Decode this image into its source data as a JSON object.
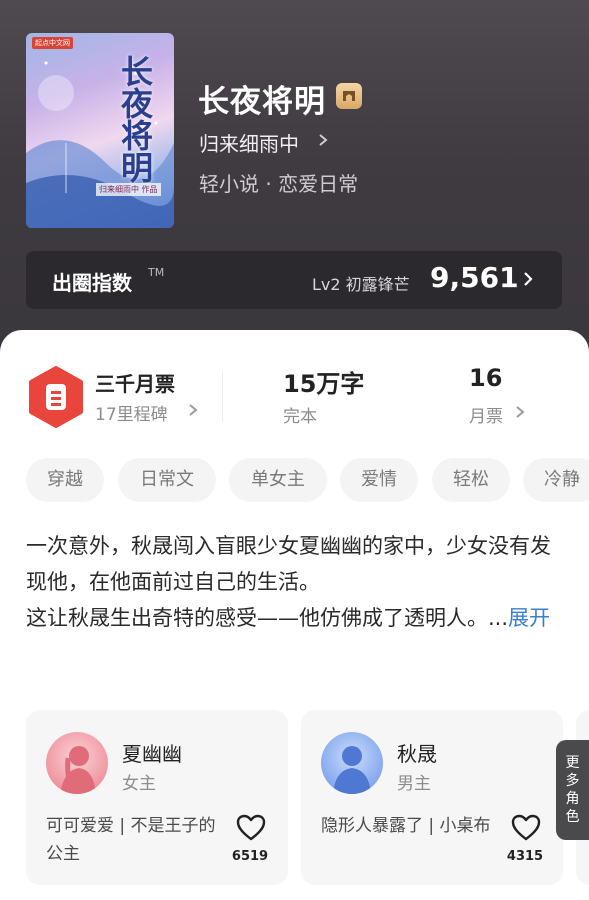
{
  "book": {
    "cover_publisher": "起点中文网",
    "cover_title": "长夜将明",
    "cover_author": "归来细雨中 作品",
    "title": "长夜将明",
    "badge_icon": "medal-icon",
    "author": "归来细雨中",
    "genre": "轻小说 · 恋爱日常"
  },
  "index": {
    "label": "出圈指数",
    "tm": "TM",
    "level": "Lv2 初露锋芒",
    "score": "9,561"
  },
  "stats": {
    "tickets_main": "三千月票",
    "tickets_sub": "17里程碑",
    "words_main": "15万字",
    "words_sub": "完本",
    "monthly_main": "16",
    "monthly_sub": "月票"
  },
  "tags": [
    "穿越",
    "日常文",
    "单女主",
    "爱情",
    "轻松",
    "冷静"
  ],
  "description": {
    "text": "一次意外，秋晟闯入盲眼少女夏幽幽的家中，少女没有发现他，在他面前过自己的生活。\n这让秋晟生出奇特的感受——他仿佛成了透明人。...",
    "more": "展开"
  },
  "characters": [
    {
      "name": "夏幽幽",
      "role": "女主",
      "desc": "可可爱爱 | 不是王子的公主",
      "likes": "6519"
    },
    {
      "name": "秋晟",
      "role": "男主",
      "desc": "隐形人暴露了 | 小桌布",
      "likes": "4315"
    }
  ],
  "more_roles": "更多角色",
  "colors": {
    "header_bg": "#3f3b41",
    "accent_red": "#e8453c",
    "link_blue": "#3a7fd0"
  }
}
